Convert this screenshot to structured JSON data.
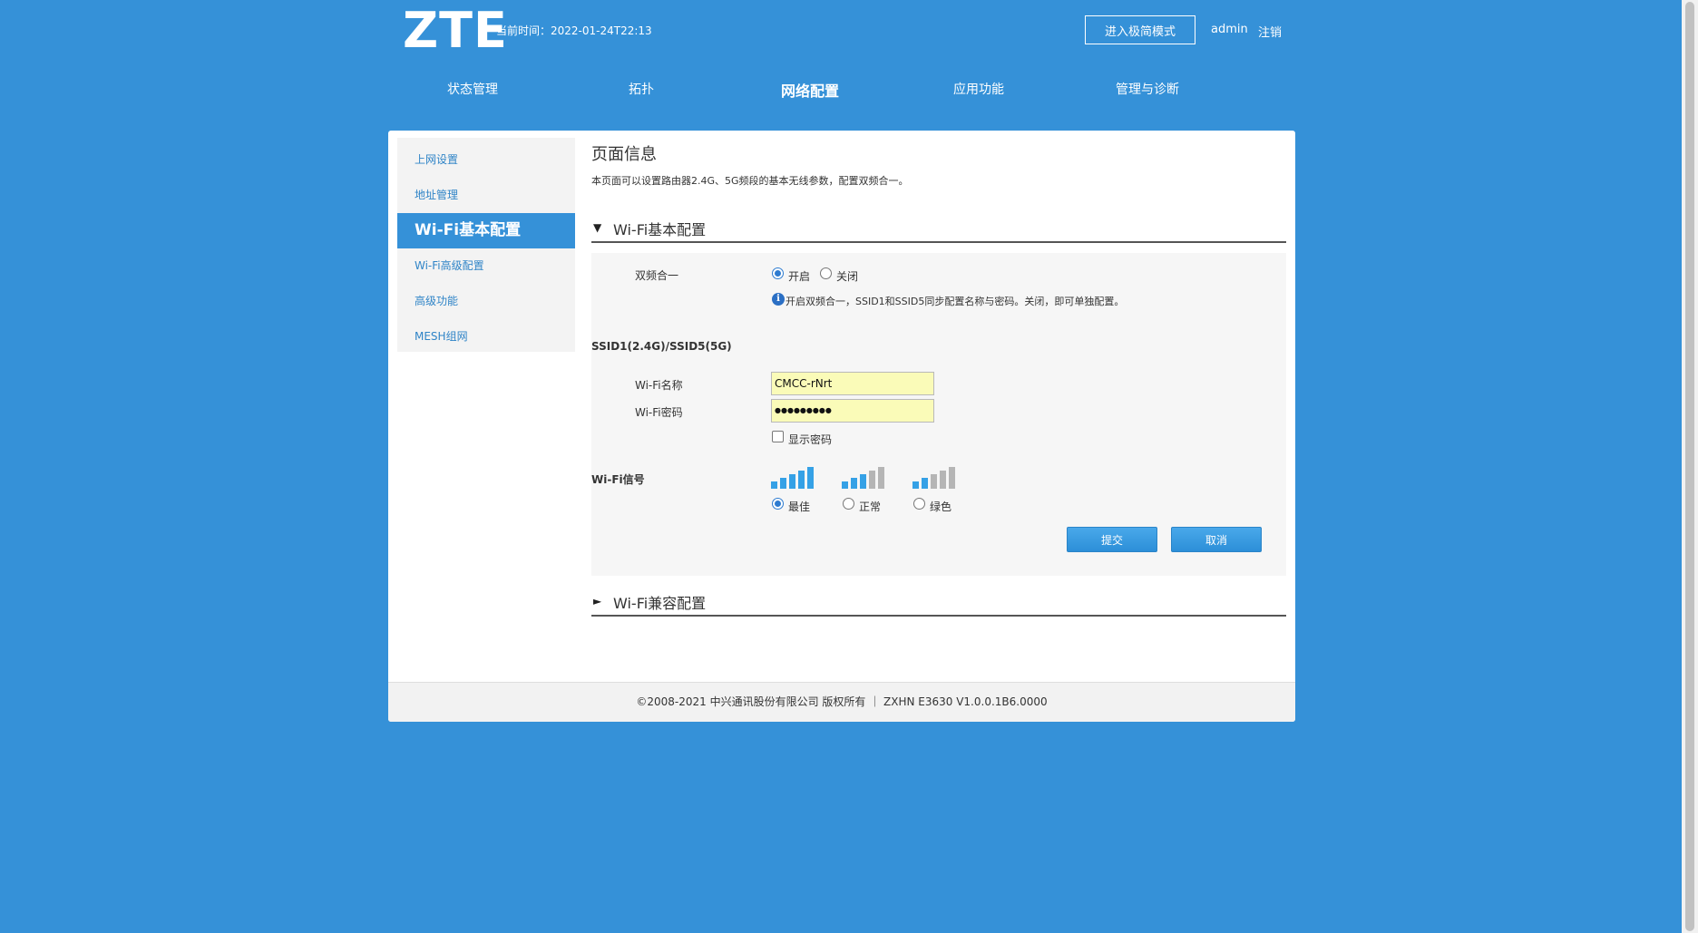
{
  "header": {
    "logo": "ZTE",
    "current_time": "当前时间：2022-01-24T22:13",
    "simple_mode_button": "进入极简模式",
    "user": "admin",
    "logout": "注销"
  },
  "nav": {
    "items": [
      {
        "label": "状态管理"
      },
      {
        "label": "拓扑"
      },
      {
        "label": "网络配置",
        "active": true
      },
      {
        "label": "应用功能"
      },
      {
        "label": "管理与诊断"
      }
    ]
  },
  "sidebar": {
    "items": [
      {
        "label": "上网设置"
      },
      {
        "label": "地址管理"
      },
      {
        "label": "Wi-Fi基本配置",
        "active": true
      },
      {
        "label": "Wi-Fi高级配置"
      },
      {
        "label": "高级功能"
      },
      {
        "label": "MESH组网"
      }
    ]
  },
  "page": {
    "title": "页面信息",
    "description": "本页面可以设置路由器2.4G、5G频段的基本无线参数，配置双频合一。"
  },
  "section_basic": {
    "arrow": "▼",
    "title": "Wi-Fi基本配置",
    "dual_band_label": "双频合一",
    "dual_band_on": "开启",
    "dual_band_off": "关闭",
    "dual_band_selected": "开启",
    "info_icon": "i",
    "info_text": "开启双频合一，SSID1和SSID5同步配置名称与密码。关闭，即可单独配置。",
    "ssid_heading": "SSID1(2.4G)/SSID5(5G)",
    "wifi_name_label": "Wi-Fi名称",
    "wifi_name_value": "CMCC-rNrt",
    "wifi_password_label": "Wi-Fi密码",
    "wifi_password_value": "●●●●●●●●●",
    "show_password_label": "显示密码",
    "show_password_checked": false,
    "signal_label": "Wi-Fi信号",
    "signal_options": [
      {
        "label": "最佳",
        "selected": true,
        "icon": "signal-strength-best-icon",
        "active_bars": 5
      },
      {
        "label": "正常",
        "selected": false,
        "icon": "signal-strength-normal-icon",
        "active_bars": 3
      },
      {
        "label": "绿色",
        "selected": false,
        "icon": "signal-strength-green-icon",
        "active_bars": 2
      }
    ],
    "submit_button": "提交",
    "cancel_button": "取消"
  },
  "section_compat": {
    "arrow": "►",
    "title": "Wi-Fi兼容配置"
  },
  "footer": {
    "text": "©2008-2021 中兴通讯股份有限公司 版权所有 ｜  ZXHN E3630 V1.0.0.1B6.0000"
  },
  "colors": {
    "background": "#3591d8",
    "accent": "#3591d8",
    "link": "#2f84c7",
    "signal_active": "#35a1e6",
    "signal_inactive": "#b5b5b5"
  }
}
